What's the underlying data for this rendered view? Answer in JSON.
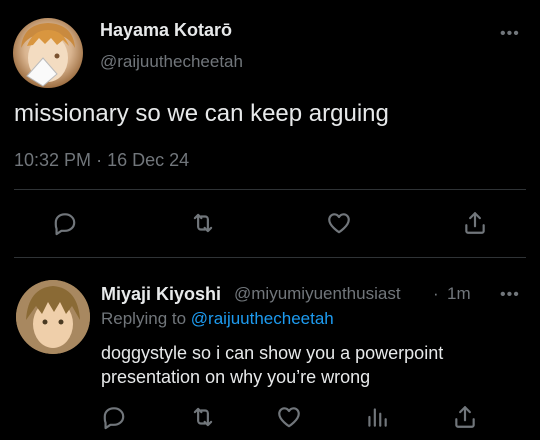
{
  "tweet": {
    "author_name": "Hayama Kotarō",
    "author_handle": "@raijuuthecheetah",
    "text": "missionary so we can keep arguing",
    "time": "10:32 PM",
    "separator": "·",
    "date": "16 Dec 24",
    "more_icon": "more-horizontal-icon",
    "actions": [
      {
        "name": "reply",
        "icon": "comment-icon"
      },
      {
        "name": "retweet",
        "icon": "retweet-icon"
      },
      {
        "name": "like",
        "icon": "heart-icon"
      },
      {
        "name": "share",
        "icon": "share-icon"
      }
    ]
  },
  "reply": {
    "author_name": "Miyaji Kiyoshi",
    "author_handle": "@miyumiyuenthusiast",
    "separator": "·",
    "time": "1m",
    "replying_to_label": "Replying to",
    "replying_to_handle": "@raijuuthecheetah",
    "text": "doggystyle so i can show you a powerpoint presentation on why you’re wrong",
    "more_icon": "more-horizontal-icon",
    "actions": [
      {
        "name": "reply",
        "icon": "comment-icon"
      },
      {
        "name": "retweet",
        "icon": "retweet-icon"
      },
      {
        "name": "like",
        "icon": "heart-icon"
      },
      {
        "name": "views",
        "icon": "bar-chart-icon"
      },
      {
        "name": "share",
        "icon": "share-icon"
      }
    ]
  },
  "colors": {
    "background": "#000000",
    "primary_text": "#e7e9ea",
    "secondary_text": "#71767b",
    "link": "#1d9bf0",
    "divider": "#2f3336"
  }
}
